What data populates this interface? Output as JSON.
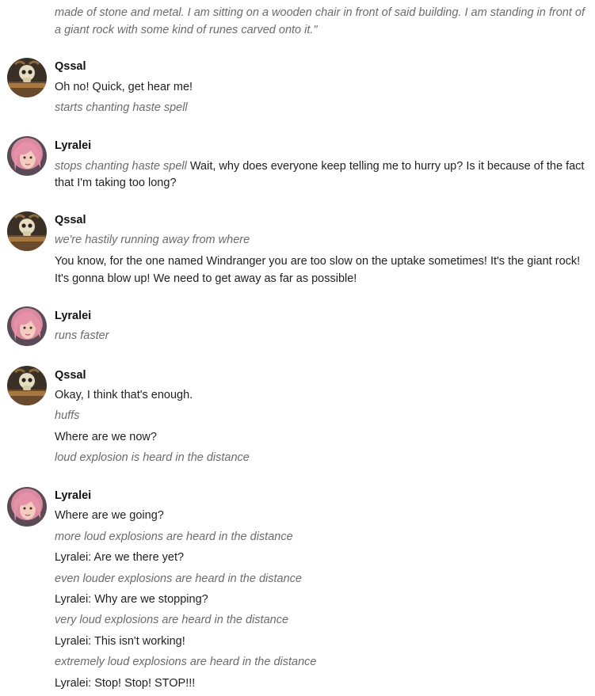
{
  "messages": [
    {
      "lines": [
        {
          "text": "made of stone and metal. I am sitting on a wooden chair in front of said building. I am standing in front of",
          "italic": true
        },
        {
          "text": "a giant rock with some kind of runes carved onto it.\"",
          "italic": true
        }
      ]
    },
    {
      "author": "Qssal",
      "avatar": "qssal-avatar",
      "lines": [
        {
          "text": "Oh no! Quick, get hear me!",
          "italic": false
        },
        {
          "text": "starts chanting haste spell",
          "italic": true
        }
      ]
    },
    {
      "author": "Lyralei",
      "avatar": "lyralei-avatar",
      "lines": [
        {
          "italic_part": "stops chanting haste spell",
          "text": " Wait, why does everyone keep telling me to hurry up? Is it because of the fact"
        },
        {
          "text": "that I'm taking too long?",
          "italic": false
        }
      ]
    },
    {
      "author": "Qssal",
      "avatar": "qssal-avatar",
      "lines": [
        {
          "text": "we're hastily running away from where",
          "italic": true
        },
        {
          "text": "You know, for the one named Windranger you are too slow on the uptake sometimes! It's the giant rock!",
          "italic": false
        },
        {
          "text": "It's gonna blow up! We need to get away as far as possible!",
          "italic": false
        }
      ]
    },
    {
      "author": "Lyralei",
      "avatar": "lyralei-avatar",
      "lines": [
        {
          "text": "runs faster",
          "italic": true
        }
      ]
    },
    {
      "author": "Qssal",
      "avatar": "qssal-avatar",
      "lines": [
        {
          "text": "Okay, I think that's enough.",
          "italic": false
        },
        {
          "text": "huffs",
          "italic": true
        },
        {
          "text": "Where are we now?",
          "italic": false
        },
        {
          "text": "loud explosion is heard in the distance",
          "italic": true
        }
      ]
    },
    {
      "author": "Lyralei",
      "avatar": "lyralei-avatar",
      "lines": [
        {
          "text": "Where are we going?",
          "italic": false
        },
        {
          "text": "more loud explosions are heard in the distance",
          "italic": true
        },
        {
          "text": "Lyralei: Are we there yet?",
          "italic": false
        },
        {
          "text": "even louder explosions are heard in the distance",
          "italic": true
        },
        {
          "text": "Lyralei: Why are we stopping?",
          "italic": false
        },
        {
          "text": "very loud explosions are heard in the distance",
          "italic": true
        },
        {
          "text": "Lyralei: This isn't working!",
          "italic": false
        },
        {
          "text": "extremely loud explosions are heard in the distance",
          "italic": true
        },
        {
          "text": "Lyralei: Stop! Stop! STOP!!!",
          "italic": false
        }
      ]
    }
  ]
}
